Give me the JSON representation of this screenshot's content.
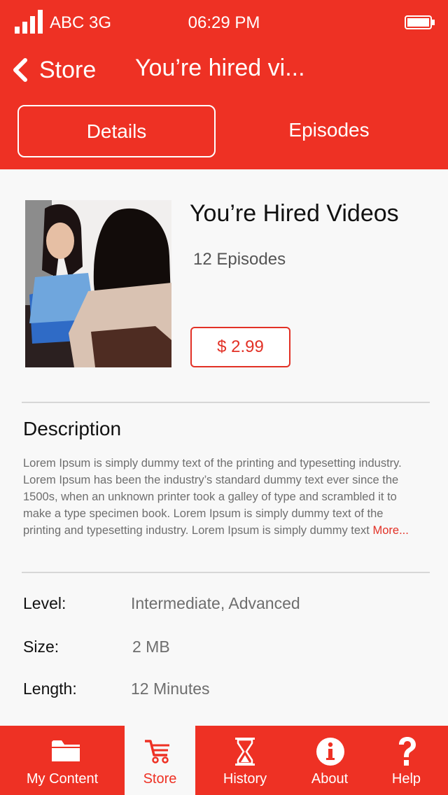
{
  "status_bar": {
    "carrier": "ABC 3G",
    "time": "06:29 PM",
    "icons": [
      "signal-icon",
      "battery-icon"
    ]
  },
  "nav": {
    "back_label": "Store",
    "title": "You’re hired vi..."
  },
  "segments": {
    "details": "Details",
    "episodes": "Episodes",
    "selected": "Details"
  },
  "product": {
    "title": "You’re Hired Videos",
    "episodes": "12 Episodes",
    "price": "$ 2.99"
  },
  "description": {
    "heading": "Description",
    "body": "Lorem Ipsum is simply dummy text of the printing and typesetting industry. Lorem Ipsum has been the industry’s standard dummy text ever since the 1500s, when an unknown printer took a galley of type and scrambled it to make a type specimen book. Lorem Ipsum is simply dummy text of the printing and typesetting industry. Lorem Ipsum is simply dummy text ",
    "more": "More..."
  },
  "details": [
    {
      "label": "Level:",
      "value": "Intermediate, Advanced"
    },
    {
      "label": "Size:",
      "value": "2 MB"
    },
    {
      "label": "Length:",
      "value": "12 Minutes"
    }
  ],
  "tabs": [
    {
      "label": "My Content",
      "icon": "folder-icon"
    },
    {
      "label": "Store",
      "icon": "cart-icon"
    },
    {
      "label": "History",
      "icon": "hourglass-icon"
    },
    {
      "label": "About",
      "icon": "info-icon"
    },
    {
      "label": "Help",
      "icon": "question-icon"
    }
  ],
  "active_tab": "Store",
  "colors": {
    "brand_red": "#ee3124",
    "price_red": "#e23126",
    "background": "#f8f8f8",
    "body_text": "#6e6e6e"
  }
}
